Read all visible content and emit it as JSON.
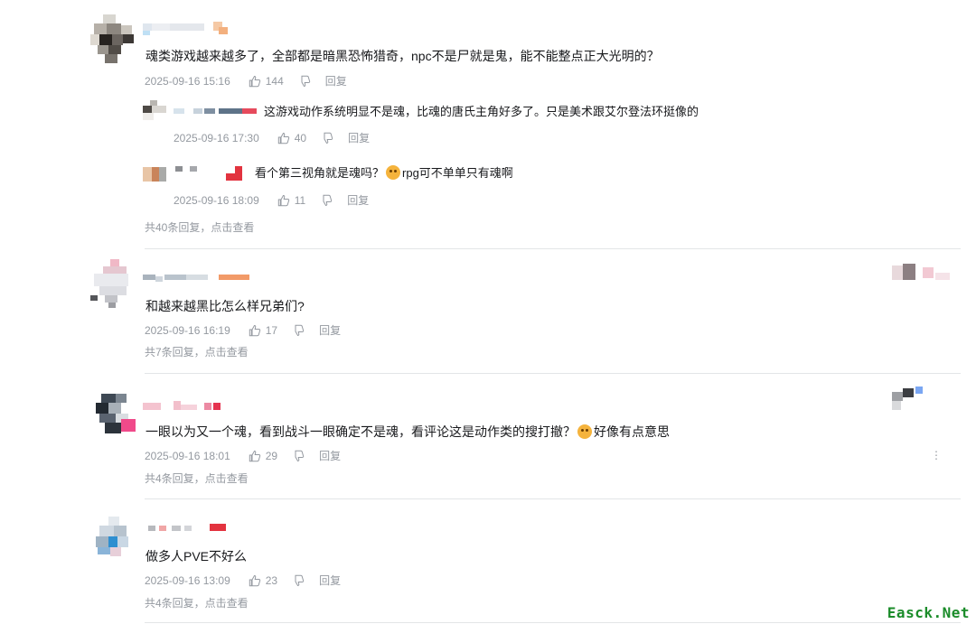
{
  "comments": [
    {
      "text": "魂类游戏越来越多了，全部都是暗黑恐怖猎奇，npc不是尸就是鬼，能不能整点正大光明的？",
      "time": "2025-09-16 15:16",
      "likes": "144",
      "reply_label": "回复",
      "replies": [
        {
          "text": "这游戏动作系统明显不是魂，比魂的唐氏主角好多了。只是美术跟艾尔登法环挺像的",
          "time": "2025-09-16 17:30",
          "likes": "40",
          "reply_label": "回复"
        },
        {
          "text_before": "看个第三视角就是魂吗？",
          "text_after": "rpg可不单单只有魂啊",
          "emoji": "crying-face-emoji",
          "time": "2025-09-16 18:09",
          "likes": "11",
          "reply_label": "回复"
        }
      ],
      "more": "共40条回复，点击查看"
    },
    {
      "text": "和越来越黑比怎么样兄弟们?",
      "time": "2025-09-16 16:19",
      "likes": "17",
      "reply_label": "回复",
      "more": "共7条回复，点击查看"
    },
    {
      "text_before": "一眼以为又一个魂，看到战斗一眼确定不是魂，看评论这是动作类的搜打撤？",
      "text_after": "好像有点意思",
      "emoji": "laughing-tears-emoji",
      "time": "2025-09-16 18:01",
      "likes": "29",
      "reply_label": "回复",
      "more": "共4条回复，点击查看",
      "menu": "⋮"
    },
    {
      "text": "做多人PVE不好么",
      "time": "2025-09-16 13:09",
      "likes": "23",
      "reply_label": "回复",
      "more": "共4条回复，点击查看"
    }
  ],
  "watermark": "Easck.Net",
  "colors": {
    "meta": "#9499a0",
    "divider": "#e3e5e7",
    "watermark": "#1b8c2a"
  }
}
